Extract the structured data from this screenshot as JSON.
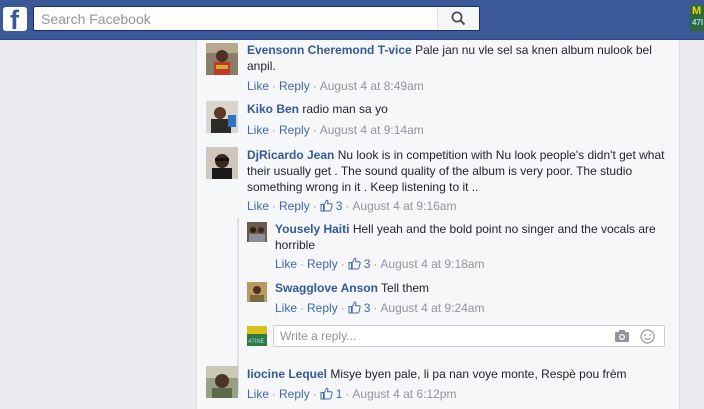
{
  "search": {
    "placeholder": "Search Facebook"
  },
  "top_thumb": {
    "line1": "M",
    "line2": "47I"
  },
  "actions": {
    "like": "Like",
    "reply": "Reply"
  },
  "comments": [
    {
      "author": "Evensonn Cheremond T-vice",
      "text": "Pale jan nu vle sel sa knen album nulook bel anpil.",
      "time": "August 4 at 8:49am",
      "likes": ""
    },
    {
      "author": "Kiko Ben",
      "text": "radio man sa yo",
      "time": "August 4 at 9:14am",
      "likes": ""
    },
    {
      "author": "DjRicardo Jean",
      "text": "Nu look is in competition with Nu look people's didn't get what their usually get . The sound quality of the album is very poor. The studio something wrong in it . Keep listening to it ..",
      "time": "August 4 at 9:16am",
      "likes": "3"
    },
    {
      "author": "Iiocine Lequel",
      "text": "Misye byen pale, li pa nan voye monte, Respè pou frèm",
      "time": "August 4 at 6:12pm",
      "likes": "1"
    }
  ],
  "replies": [
    {
      "author": "Yousely Haiti",
      "text": "Hell yeah and the bold point no singer and the vocals are horrible",
      "time": "August 4 at 9:18am",
      "likes": "3"
    },
    {
      "author": "Swagglove Anson",
      "text": "Tell them",
      "time": "August 4 at 9:24am",
      "likes": "3"
    }
  ],
  "reply_composer": {
    "placeholder": "Write a reply...",
    "avatar_text": "47INE"
  },
  "colors": {
    "topbar": "#3b5998",
    "link": "#4267b2",
    "author": "#365899",
    "meta": "#90949c"
  }
}
